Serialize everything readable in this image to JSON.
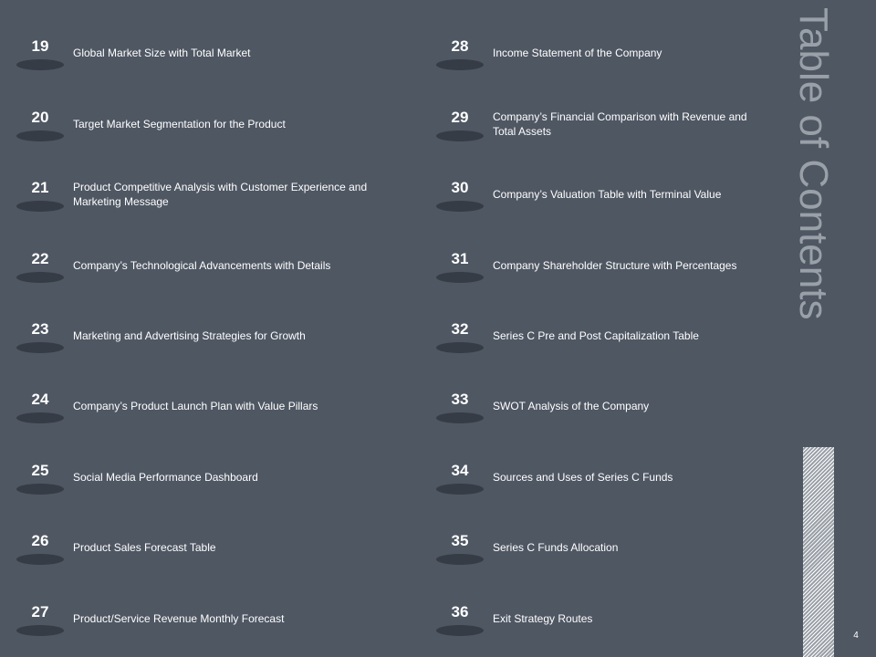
{
  "title": "Table of Contents",
  "page_number": "4",
  "left_items": [
    {
      "num": "19",
      "label": "Global Market Size with Total Market"
    },
    {
      "num": "20",
      "label": "Target Market Segmentation for the Product"
    },
    {
      "num": "21",
      "label": "Product Competitive Analysis with Customer Experience and Marketing Message"
    },
    {
      "num": "22",
      "label": "Company’s Technological Advancements with Details"
    },
    {
      "num": "23",
      "label": "Marketing and Advertising Strategies for Growth"
    },
    {
      "num": "24",
      "label": "Company’s Product Launch Plan with Value Pillars"
    },
    {
      "num": "25",
      "label": "Social Media Performance Dashboard"
    },
    {
      "num": "26",
      "label": "Product Sales Forecast Table"
    },
    {
      "num": "27",
      "label": "Product/Service Revenue Monthly Forecast"
    }
  ],
  "right_items": [
    {
      "num": "28",
      "label": "Income Statement of the Company"
    },
    {
      "num": "29",
      "label": "Company’s Financial Comparison with Revenue and Total Assets"
    },
    {
      "num": "30",
      "label": "Company’s Valuation Table with Terminal Value"
    },
    {
      "num": "31",
      "label": "Company Shareholder Structure with Percentages"
    },
    {
      "num": "32",
      "label": "Series C Pre and Post Capitalization Table"
    },
    {
      "num": "33",
      "label": "SWOT Analysis of the Company"
    },
    {
      "num": "34",
      "label": "Sources and Uses of Series C Funds"
    },
    {
      "num": "35",
      "label": "Series C Funds Allocation"
    },
    {
      "num": "36",
      "label": "Exit Strategy Routes"
    }
  ]
}
